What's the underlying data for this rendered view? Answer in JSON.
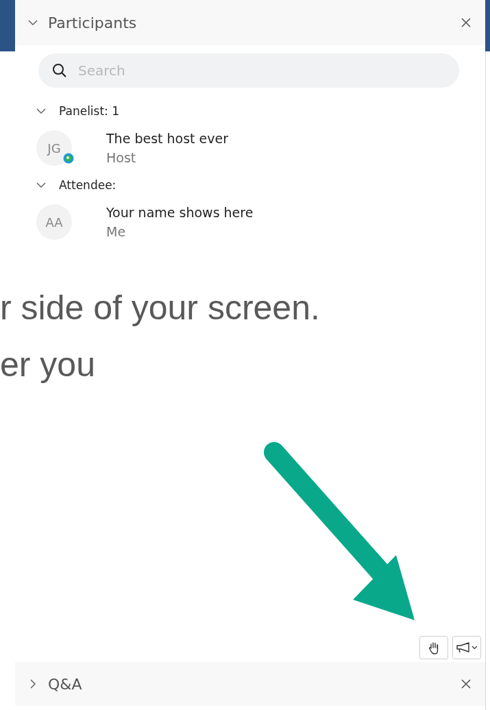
{
  "panel": {
    "title": "Participants",
    "expanded": true
  },
  "search": {
    "placeholder": "Search"
  },
  "groups": [
    {
      "label": "Panelist: 1",
      "expanded": true,
      "members": [
        {
          "initials": "JG",
          "name": "The best host ever",
          "role": "Host",
          "badge": true
        }
      ]
    },
    {
      "label": "Attendee:",
      "expanded": true,
      "members": [
        {
          "initials": "AA",
          "name": "Your name shows here",
          "role": "Me",
          "badge": false
        }
      ]
    }
  ],
  "slide_text": [
    "r side of your screen.",
    "er you"
  ],
  "actions": [
    {
      "kind": "raise-hand"
    },
    {
      "kind": "announce-menu"
    }
  ],
  "collapsed_panel": {
    "title": "Q&A",
    "expanded": false
  }
}
